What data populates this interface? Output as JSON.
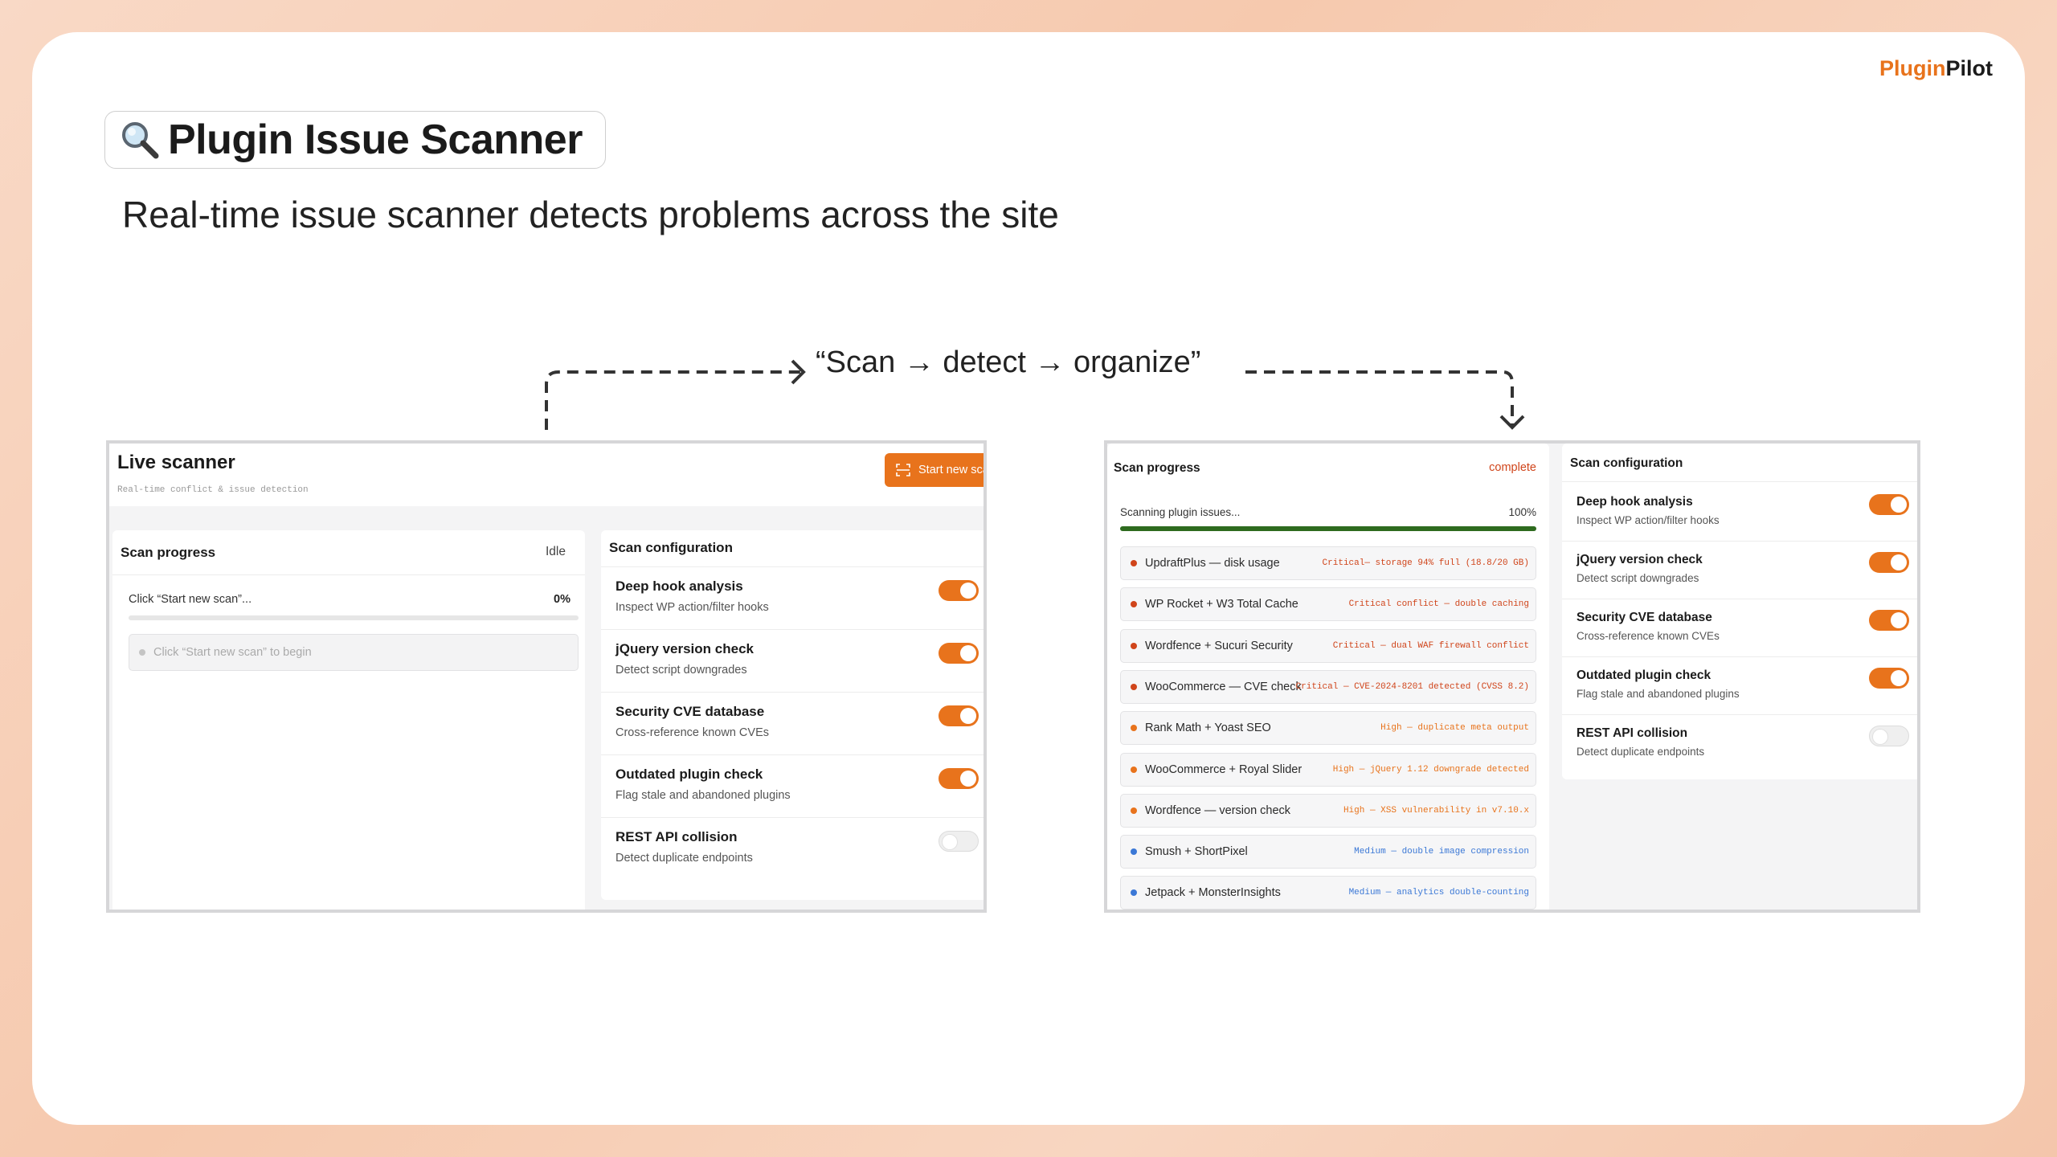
{
  "brand": {
    "part1": "Plugin",
    "part2": "Pilot"
  },
  "title": "Plugin Issue Scanner",
  "subtitle": "Real-time issue scanner detects problems across the site",
  "flow_label": "“Scan → detect → organize”",
  "colors": {
    "accent": "#e8731c",
    "progress_green": "#2e6b1f",
    "critical": "#d0451b",
    "high": "#e8731c",
    "medium": "#3b78d6"
  },
  "left_panel": {
    "title": "Live scanner",
    "subtitle": "Real-time conflict & issue detection",
    "start_button": "Start new scan",
    "progress": {
      "heading": "Scan progress",
      "status": "Idle",
      "label": "Click “Start new scan”...",
      "percent_label": "0%",
      "fill": 0,
      "placeholder": "Click “Start new scan” to begin"
    },
    "config": {
      "heading": "Scan configuration",
      "items": [
        {
          "title": "Deep hook analysis",
          "sub": "Inspect WP action/filter hooks",
          "on": true
        },
        {
          "title": "jQuery version check",
          "sub": "Detect script downgrades",
          "on": true
        },
        {
          "title": "Security CVE database",
          "sub": "Cross-reference known CVEs",
          "on": true
        },
        {
          "title": "Outdated plugin check",
          "sub": "Flag stale and abandoned plugins",
          "on": true
        },
        {
          "title": "REST API collision",
          "sub": "Detect duplicate endpoints",
          "on": false
        }
      ]
    }
  },
  "right_panel": {
    "progress": {
      "heading": "Scan progress",
      "status": "complete",
      "label": "Scanning plugin issues...",
      "percent_label": "100%",
      "fill": 1
    },
    "issues": [
      {
        "name": "UpdraftPlus — disk usage",
        "status": "Critical— storage 94% full (18.8/20 GB)",
        "severity": "critical"
      },
      {
        "name": "WP Rocket + W3 Total Cache",
        "status": "Critical conflict — double caching",
        "severity": "critical"
      },
      {
        "name": "Wordfence + Sucuri Security",
        "status": "Critical — dual WAF firewall conflict",
        "severity": "critical"
      },
      {
        "name": "WooCommerce — CVE check",
        "status": "Critical — CVE-2024-8201 detected (CVSS 8.2)",
        "severity": "critical"
      },
      {
        "name": "Rank Math + Yoast SEO",
        "status": "High — duplicate meta output",
        "severity": "high"
      },
      {
        "name": "WooCommerce + Royal Slider",
        "status": "High — jQuery 1.12 downgrade detected",
        "severity": "high"
      },
      {
        "name": "Wordfence — version check",
        "status": "High — XSS vulnerability in v7.10.x",
        "severity": "high"
      },
      {
        "name": "Smush + ShortPixel",
        "status": "Medium — double image compression",
        "severity": "medium"
      },
      {
        "name": "Jetpack + MonsterInsights",
        "status": "Medium — analytics double-counting",
        "severity": "medium"
      }
    ],
    "config": {
      "heading": "Scan configuration",
      "items": [
        {
          "title": "Deep hook analysis",
          "sub": "Inspect WP action/filter hooks",
          "on": true
        },
        {
          "title": "jQuery version check",
          "sub": "Detect script downgrades",
          "on": true
        },
        {
          "title": "Security CVE database",
          "sub": "Cross-reference known CVEs",
          "on": true
        },
        {
          "title": "Outdated plugin check",
          "sub": "Flag stale and abandoned plugins",
          "on": true
        },
        {
          "title": "REST API collision",
          "sub": "Detect duplicate endpoints",
          "on": false
        }
      ]
    }
  }
}
